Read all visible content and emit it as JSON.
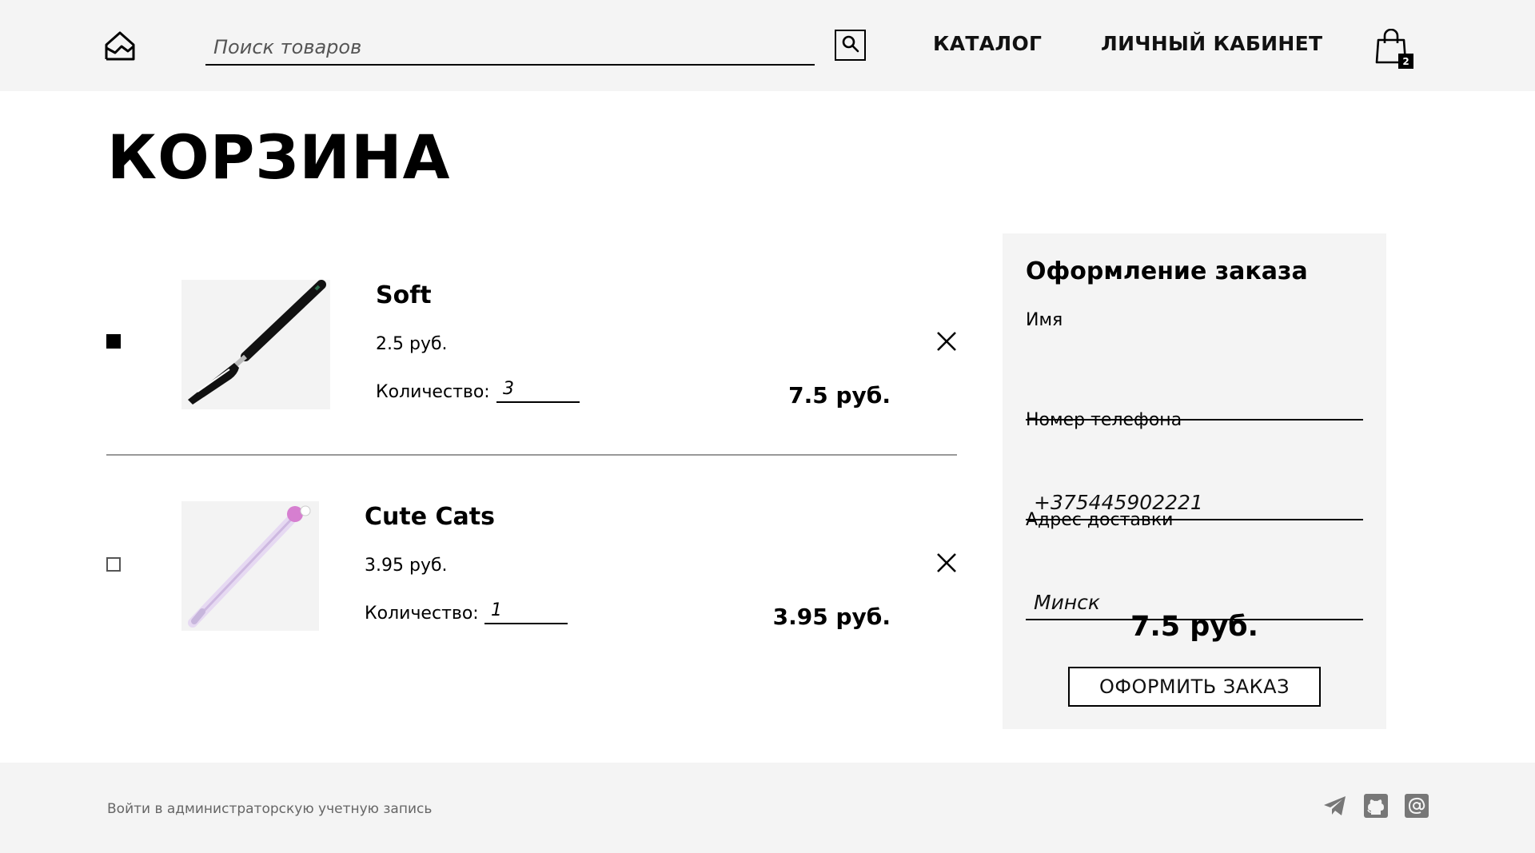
{
  "header": {
    "search_placeholder": "Поиск товаров",
    "nav": {
      "catalog": "КАТАЛОГ",
      "account": "ЛИЧНЫЙ КАБИНЕТ"
    },
    "cart_count": "2"
  },
  "page": {
    "title": "КОРЗИНА"
  },
  "cart": {
    "items": [
      {
        "name": "Soft",
        "price": "2.5 руб.",
        "qty_label": "Количество:",
        "qty": "3",
        "total": "7.5 руб.",
        "selected": true
      },
      {
        "name": "Cute Cats",
        "price": "3.95 руб.",
        "qty_label": "Количество:",
        "qty": "1",
        "total": "3.95 руб.",
        "selected": false
      }
    ]
  },
  "order": {
    "title": "Оформление заказа",
    "name_label": "Имя",
    "name_value": "",
    "phone_label": "Номер телефона",
    "phone_value": "+375445902221",
    "address_label": "Адрес доставки",
    "address_value": "Минск",
    "total": "7.5 руб.",
    "submit_label": "ОФОРМИТЬ ЗАКАЗ"
  },
  "footer": {
    "admin_link": "Войти в администраторскую учетную запись"
  },
  "colors": {
    "header_bg": "#f4f4f4",
    "panel_bg": "#f4f4f4",
    "footer_bg": "#f4f4f4",
    "text": "#000000"
  },
  "icons": [
    "logo-icon",
    "search-icon",
    "shopping-bag-icon",
    "close-icon",
    "telegram-icon",
    "github-icon",
    "at-sign-icon"
  ]
}
